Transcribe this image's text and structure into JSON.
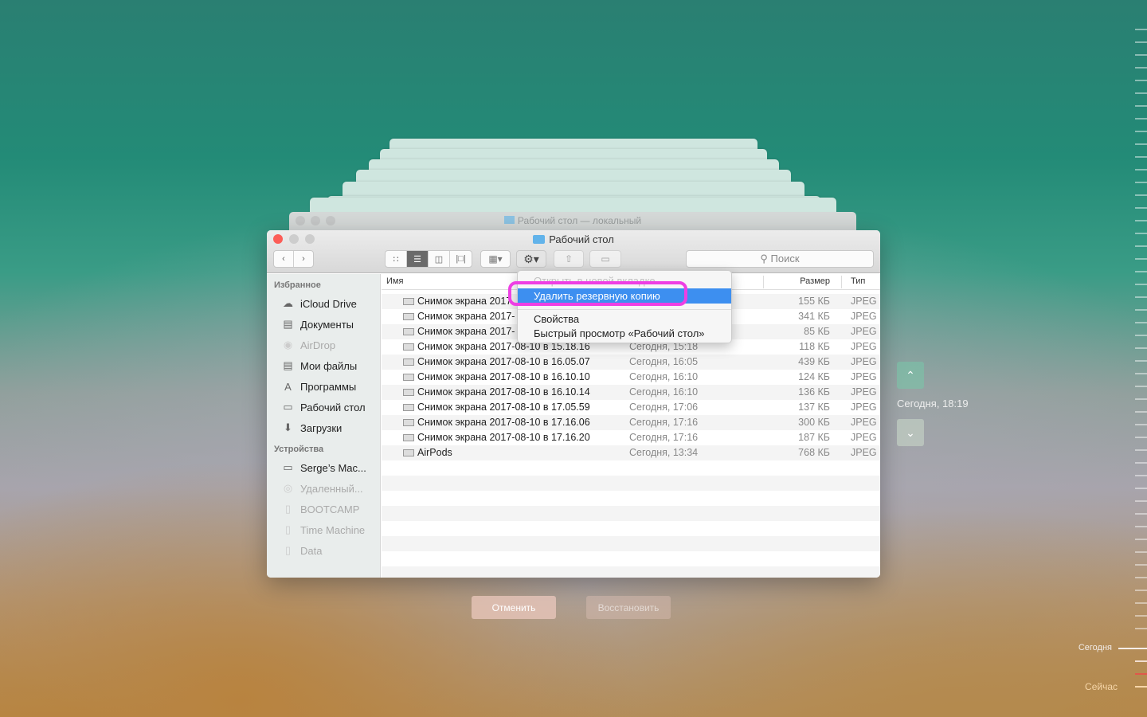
{
  "background_window": {
    "title": "Рабочий стол — локальный"
  },
  "window": {
    "title": "Рабочий стол",
    "search_placeholder": "Поиск",
    "view_modes": [
      "icons",
      "list",
      "columns",
      "cover-flow"
    ],
    "active_view": "list"
  },
  "sidebar": {
    "favorites_header": "Избранное",
    "favorites": [
      {
        "label": "iCloud Drive",
        "icon": "cloud-icon",
        "dim": false
      },
      {
        "label": "Документы",
        "icon": "documents-icon",
        "dim": false
      },
      {
        "label": "AirDrop",
        "icon": "airdrop-icon",
        "dim": true
      },
      {
        "label": "Мои файлы",
        "icon": "all-files-icon",
        "dim": false
      },
      {
        "label": "Программы",
        "icon": "applications-icon",
        "dim": false
      },
      {
        "label": "Рабочий стол",
        "icon": "desktop-icon",
        "dim": false
      },
      {
        "label": "Загрузки",
        "icon": "downloads-icon",
        "dim": false
      }
    ],
    "devices_header": "Устройства",
    "devices": [
      {
        "label": "Serge’s Mac...",
        "icon": "laptop-icon",
        "dim": false
      },
      {
        "label": "Удаленный...",
        "icon": "remote-disc-icon",
        "dim": true
      },
      {
        "label": "BOOTCAMP",
        "icon": "disk-icon",
        "dim": true
      },
      {
        "label": "Time Machine",
        "icon": "time-machine-disk-icon",
        "dim": true
      },
      {
        "label": "Data",
        "icon": "disk-icon",
        "dim": true
      }
    ]
  },
  "columns": {
    "name": "Имя",
    "size": "Размер",
    "type": "Тип"
  },
  "files": [
    {
      "name": "Снимок экрана 2017",
      "date": "",
      "size": "155 КБ",
      "type": "JPEG"
    },
    {
      "name": "Снимок экрана 2017-",
      "date": "",
      "size": "341 КБ",
      "type": "JPEG"
    },
    {
      "name": "Снимок экрана 2017-",
      "date": "",
      "size": "85 КБ",
      "type": "JPEG"
    },
    {
      "name": "Снимок экрана 2017-08-10 в 15.18.16",
      "date": "Сегодня, 15:18",
      "size": "118 КБ",
      "type": "JPEG"
    },
    {
      "name": "Снимок экрана 2017-08-10 в 16.05.07",
      "date": "Сегодня, 16:05",
      "size": "439 КБ",
      "type": "JPEG"
    },
    {
      "name": "Снимок экрана 2017-08-10 в 16.10.10",
      "date": "Сегодня, 16:10",
      "size": "124 КБ",
      "type": "JPEG"
    },
    {
      "name": "Снимок экрана 2017-08-10 в 16.10.14",
      "date": "Сегодня, 16:10",
      "size": "136 КБ",
      "type": "JPEG"
    },
    {
      "name": "Снимок экрана 2017-08-10 в 17.05.59",
      "date": "Сегодня, 17:06",
      "size": "137 КБ",
      "type": "JPEG"
    },
    {
      "name": "Снимок экрана 2017-08-10 в 17.16.06",
      "date": "Сегодня, 17:16",
      "size": "300 КБ",
      "type": "JPEG"
    },
    {
      "name": "Снимок экрана 2017-08-10 в 17.16.20",
      "date": "Сегодня, 17:16",
      "size": "187 КБ",
      "type": "JPEG"
    },
    {
      "name": "AirPods",
      "date": "Сегодня, 13:34",
      "size": "768 КБ",
      "type": "JPEG"
    }
  ],
  "context_menu": {
    "items": [
      {
        "label": "Открыть в новой вкладке",
        "disabled": true
      },
      {
        "label": "Удалить резервную копию",
        "highlighted": true
      },
      {
        "label": "Свойства"
      },
      {
        "label": "Быстрый просмотр «Рабочий стол»"
      }
    ],
    "highlight_ring_color": "#ee3fe4"
  },
  "time_machine": {
    "cancel": "Отменить",
    "restore": "Восстановить",
    "current_snapshot": "Сегодня, 18:19",
    "timeline_today": "Сегодня",
    "timeline_now": "Сейчас"
  }
}
